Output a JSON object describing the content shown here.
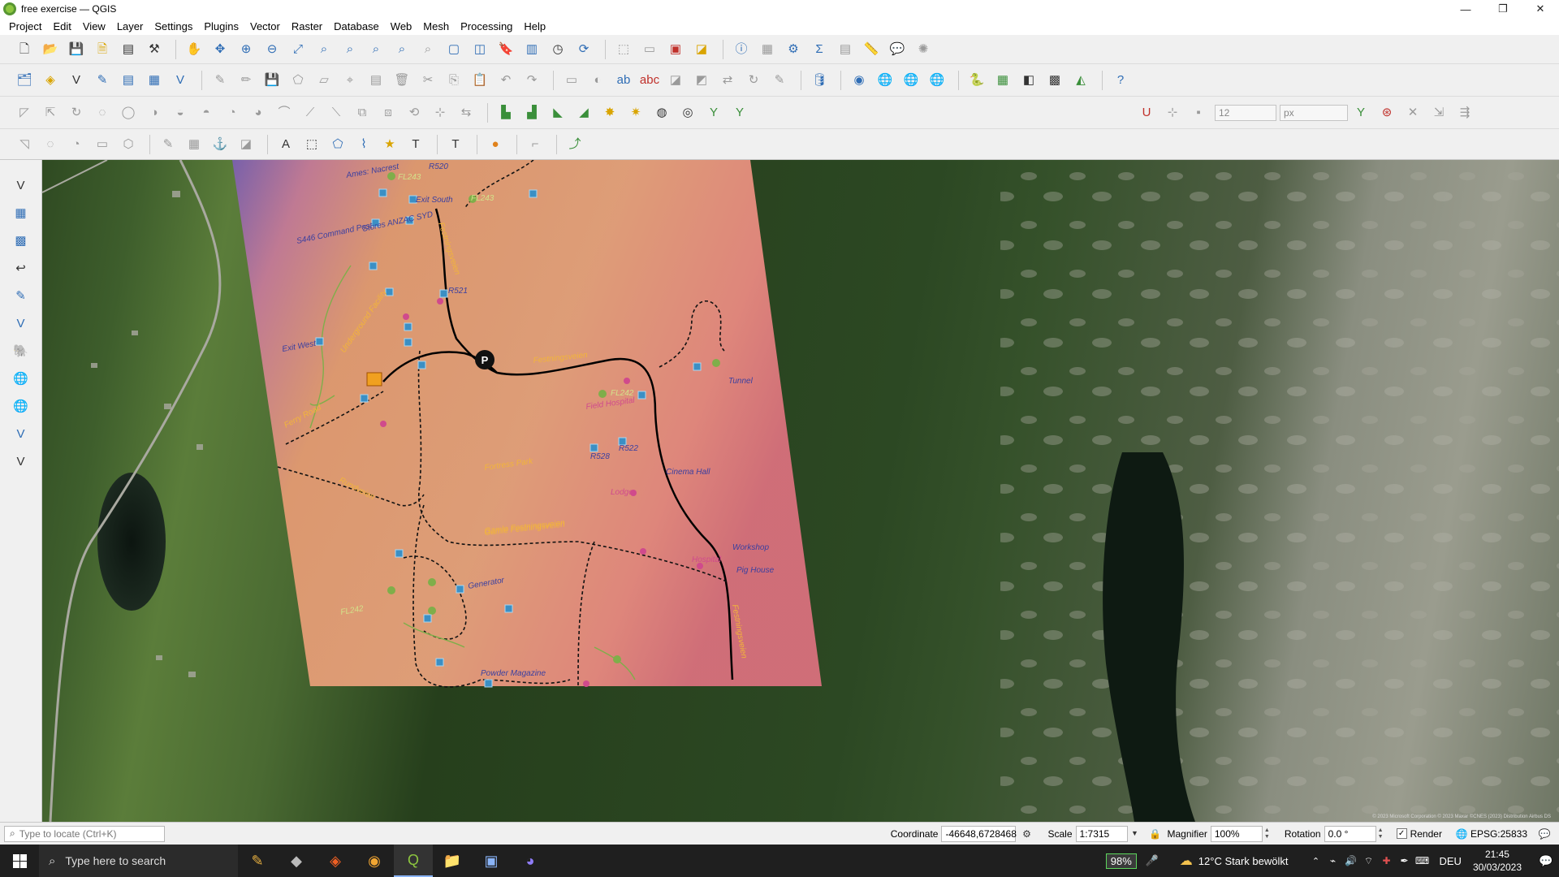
{
  "window": {
    "title": "free exercise — QGIS",
    "minimize": "—",
    "maximize": "❐",
    "close": "✕"
  },
  "menu": [
    "Project",
    "Edit",
    "View",
    "Layer",
    "Settings",
    "Plugins",
    "Vector",
    "Raster",
    "Database",
    "Web",
    "Mesh",
    "Processing",
    "Help"
  ],
  "toolbar3": {
    "size_value": "12",
    "unit_value": "px"
  },
  "map": {
    "labels": [
      {
        "text": "Ames: Nacrest"
      },
      {
        "text": "FL243"
      },
      {
        "text": "R520"
      },
      {
        "text": "Exit South"
      },
      {
        "text": "FL243"
      },
      {
        "text": "S446 Command Post"
      },
      {
        "text": "Stores ANZAC SYD"
      },
      {
        "text": "Festningsveien"
      },
      {
        "text": "R521"
      },
      {
        "text": "Exit West"
      },
      {
        "text": "Underground Facility"
      },
      {
        "text": "Fortress Park"
      },
      {
        "text": "Festningsveien"
      },
      {
        "text": "Field Hospital"
      },
      {
        "text": "FL242"
      },
      {
        "text": "R528"
      },
      {
        "text": "R522"
      },
      {
        "text": "Ferry Road"
      },
      {
        "text": "Rundveien"
      },
      {
        "text": "Gamle Festningsveien"
      },
      {
        "text": "Generator"
      },
      {
        "text": "FL242"
      },
      {
        "text": "Festningsveien"
      },
      {
        "text": "Workshop"
      },
      {
        "text": "Pig House"
      },
      {
        "text": "Tunnel"
      },
      {
        "text": "Cinema Hall"
      },
      {
        "text": "Gamle Festningsveien"
      },
      {
        "text": "Hospital"
      },
      {
        "text": "Lodge"
      },
      {
        "text": "Powder Magazine"
      }
    ],
    "attribution": "© 2023 Microsoft Corporation © 2023 Maxar ©CNES (2023) Distribution Airbus DS"
  },
  "status": {
    "locate_placeholder": "Type to locate (Ctrl+K)",
    "coordinate_label": "Coordinate",
    "coordinate_value": "-46648,6728468",
    "scale_label": "Scale",
    "scale_value": "1:7315",
    "magnifier_label": "Magnifier",
    "magnifier_value": "100%",
    "rotation_label": "Rotation",
    "rotation_value": "0.0 °",
    "render_label": "Render",
    "crs": "EPSG:25833"
  },
  "taskbar": {
    "search_placeholder": "Type here to search",
    "battery": "98%",
    "weather": "12°C  Stark bewölkt",
    "lang": "DEU",
    "time": "21:45",
    "date": "30/03/2023"
  },
  "colors": {
    "title_bg": "#ffffff",
    "hillshade_top": "#7a5fb0",
    "hillshade_mid": "#e39a72",
    "road": "#000000",
    "trail": "#1a1a1a",
    "taskbar_bg": "#1f1f1f"
  }
}
